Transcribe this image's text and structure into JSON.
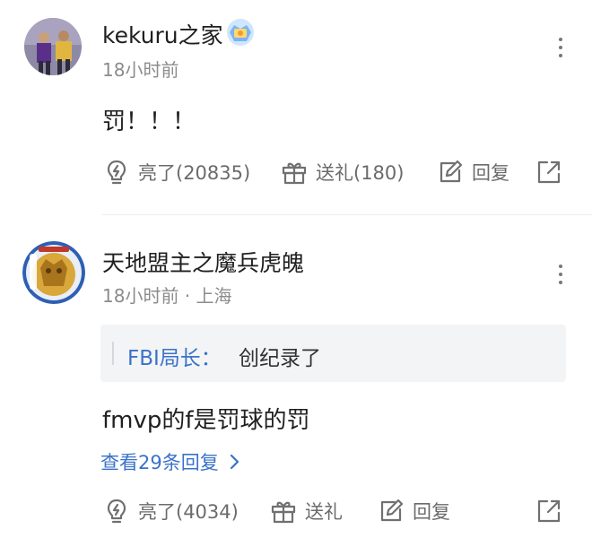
{
  "comments": [
    {
      "username": "kekuru之家",
      "time": "18小时前",
      "text": "罚！！！",
      "actions": {
        "like_label": "亮了(20835)",
        "gift_label": "送礼(180)",
        "reply_label": "回复"
      }
    },
    {
      "username": "天地盟主之魔兵虎魄",
      "time": "18小时前 · 上海",
      "quote": {
        "author": "FBI局长：",
        "text": "创纪录了"
      },
      "text": "fmvp的f是罚球的罚",
      "view_replies_label": "查看29条回复",
      "actions": {
        "like_label": "亮了(4034)",
        "gift_label": "送礼",
        "reply_label": "回复"
      }
    }
  ],
  "icons": {
    "like": "lightbulb-icon",
    "gift": "gift-icon",
    "reply": "edit-icon",
    "share": "share-icon",
    "more": "more-vertical-icon",
    "badge": "badge-icon",
    "chevron": "chevron-right-icon"
  },
  "colors": {
    "link": "#3a72c8",
    "meta": "#8c8c8c",
    "icon": "#707070",
    "quote_bg": "#f3f4f6"
  }
}
